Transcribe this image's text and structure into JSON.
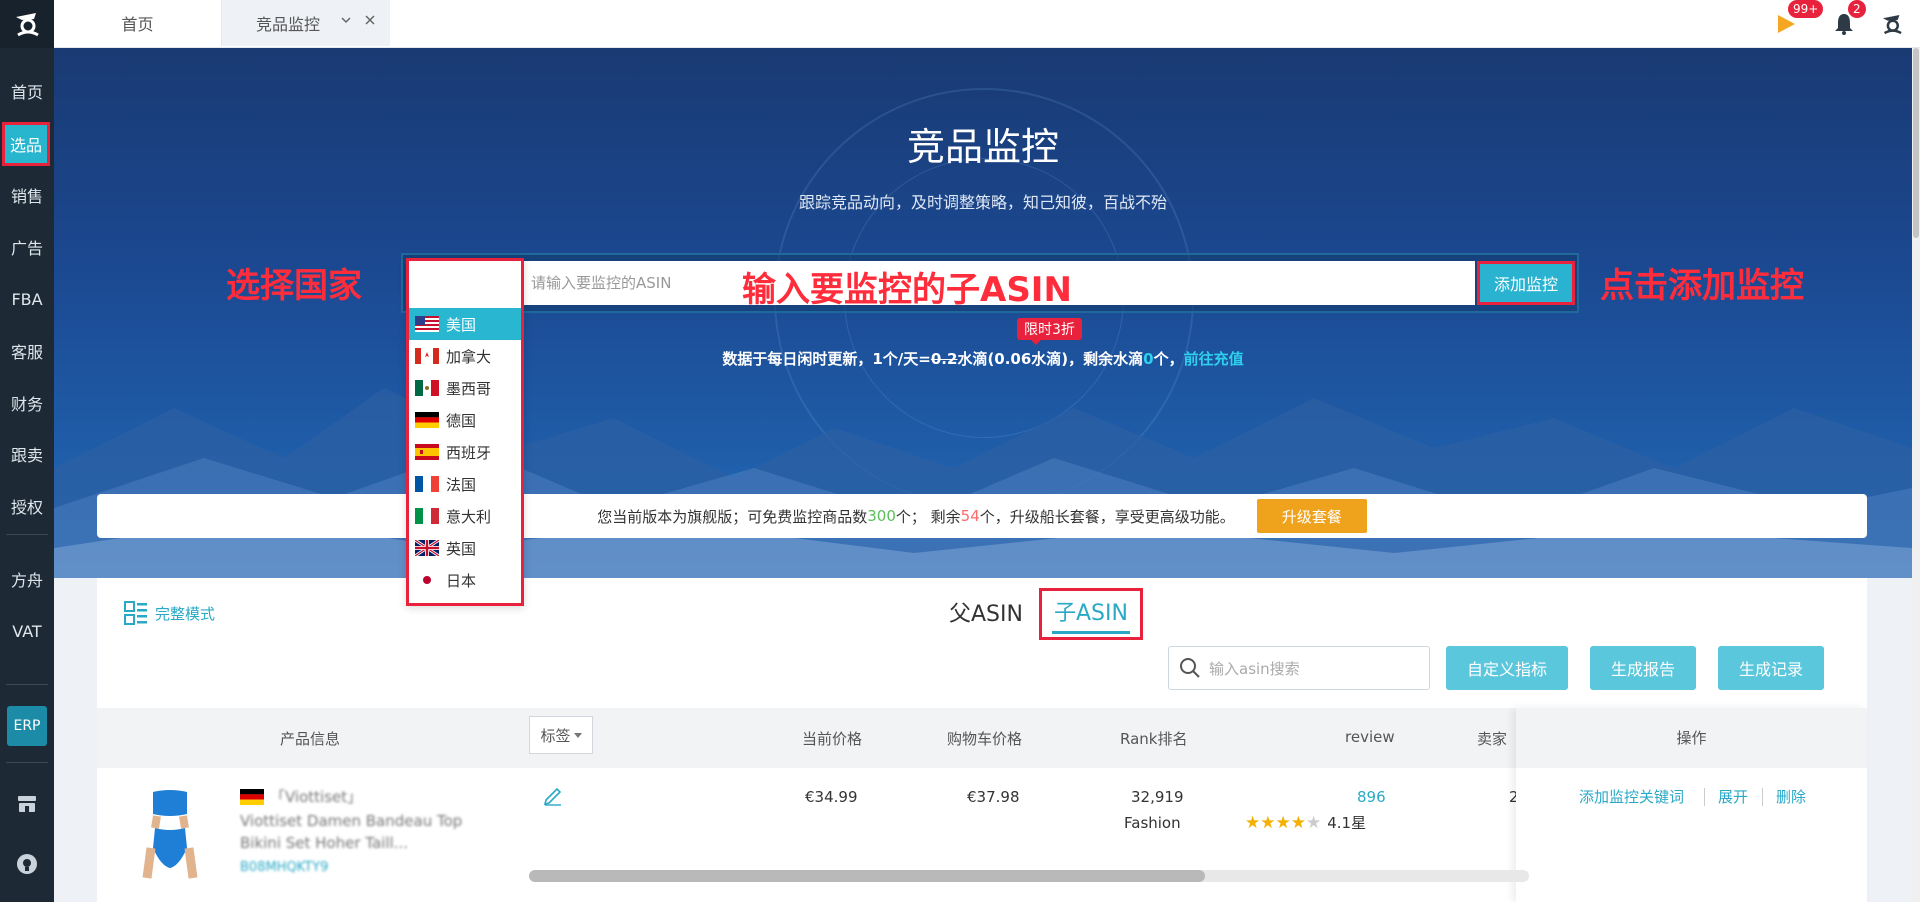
{
  "sidebar": {
    "items": [
      {
        "label": "首页"
      },
      {
        "label": "选品"
      },
      {
        "label": "销售"
      },
      {
        "label": "广告"
      },
      {
        "label": "FBA"
      },
      {
        "label": "客服"
      },
      {
        "label": "财务"
      },
      {
        "label": "跟卖"
      },
      {
        "label": "授权"
      },
      {
        "label": "方舟"
      },
      {
        "label": "VAT"
      }
    ],
    "erp_label": "ERP"
  },
  "topbar": {
    "tabs": [
      {
        "label": "首页"
      },
      {
        "label": "竞品监控"
      }
    ],
    "flag_badge": "99+",
    "bell_badge": "2"
  },
  "hero": {
    "title": "竞品监控",
    "subtitle": "跟踪竞品动向，及时调整策略，知己知彼，百战不殆",
    "selected_country": "美国",
    "asin_placeholder": "请输入要监控的ASIN",
    "add_button": "添加监控",
    "limit_badge": "限时3折",
    "info": {
      "part1": "数据于每日闲时更新，1个/天=",
      "old_price": "0.2",
      "part2": "水滴(0.06水滴)，剩余水滴",
      "remaining": "0",
      "part3": "个，",
      "recharge_link": "前往充值"
    }
  },
  "annotations": {
    "select_country": "选择国家",
    "input_asin": "输入要监控的子ASIN",
    "click_add": "点击添加监控"
  },
  "notice": {
    "part1": "您当前版本为旗舰版；可免费监控商品数",
    "free_count": "300",
    "part2": "个；  剩余",
    "remaining": "54",
    "part3": "个，升级船长套餐，享受更高级功能。",
    "upgrade_button": "升级套餐"
  },
  "countries": [
    {
      "label": "美国",
      "flag": "us"
    },
    {
      "label": "加拿大",
      "flag": "ca"
    },
    {
      "label": "墨西哥",
      "flag": "mx"
    },
    {
      "label": "德国",
      "flag": "de"
    },
    {
      "label": "西班牙",
      "flag": "es"
    },
    {
      "label": "法国",
      "flag": "fr"
    },
    {
      "label": "意大利",
      "flag": "it"
    },
    {
      "label": "英国",
      "flag": "uk"
    },
    {
      "label": "日本",
      "flag": "jp"
    }
  ],
  "panel": {
    "mode_label": "完整模式",
    "parent_tab": "父ASIN",
    "child_tab": "子ASIN",
    "search_placeholder": "输入asin搜索",
    "btn_custom": "自定义指标",
    "btn_report": "生成报告",
    "btn_records": "生成记录",
    "columns": {
      "product": "产品信息",
      "tag": "标签",
      "price": "当前价格",
      "cart_price": "购物车价格",
      "rank": "Rank排名",
      "review": "review",
      "seller": "卖家",
      "ops": "操作"
    },
    "row": {
      "brand": "「Viottiset」",
      "title_line1": "Viottiset Damen Bandeau Top",
      "title_line2": "Bikini Set Hoher Taill...",
      "asin": "B08MHQKTY9",
      "price": "€34.99",
      "cart_price": "€37.98",
      "rank": "32,919",
      "rank_category": "Fashion",
      "review_count": "896",
      "rating": 4.1,
      "rating_label": "4.1星",
      "seller_partial": "2",
      "op_add_keyword": "添加监控关键词",
      "op_expand": "展开",
      "op_delete": "删除"
    }
  },
  "colors": {
    "accent": "#29b3d1",
    "annotation_red": "#ff2d3c",
    "sidebar_bg": "#1d2a35",
    "upgrade": "#efa21c"
  }
}
